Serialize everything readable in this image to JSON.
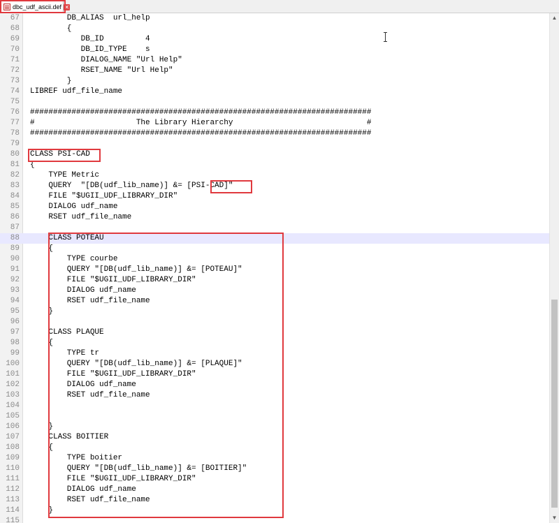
{
  "tab": {
    "label": "dbc_udf_ascii.def",
    "close_glyph": "✕",
    "icon": "file-icon"
  },
  "accent_color": "#e0393e",
  "current_line_number": "88",
  "lines": [
    {
      "n": "67",
      "t": "        DB_ALIAS  url_help"
    },
    {
      "n": "68",
      "t": "        {"
    },
    {
      "n": "69",
      "t": "           DB_ID         4"
    },
    {
      "n": "70",
      "t": "           DB_ID_TYPE    s"
    },
    {
      "n": "71",
      "t": "           DIALOG_NAME \"Url Help\""
    },
    {
      "n": "72",
      "t": "           RSET_NAME \"Url Help\""
    },
    {
      "n": "73",
      "t": "        }"
    },
    {
      "n": "74",
      "t": "LIBREF udf_file_name"
    },
    {
      "n": "75",
      "t": ""
    },
    {
      "n": "76",
      "t": "##########################################################################"
    },
    {
      "n": "77",
      "t": "#                      The Library Hierarchy                             #"
    },
    {
      "n": "78",
      "t": "##########################################################################"
    },
    {
      "n": "79",
      "t": ""
    },
    {
      "n": "80",
      "t": "CLASS PSI-CAD"
    },
    {
      "n": "81",
      "t": "{"
    },
    {
      "n": "82",
      "t": "    TYPE Metric"
    },
    {
      "n": "83",
      "t": "    QUERY  \"[DB(udf_lib_name)] &= [PSI-CAD]\""
    },
    {
      "n": "84",
      "t": "    FILE \"$UGII_UDF_LIBRARY_DIR\""
    },
    {
      "n": "85",
      "t": "    DIALOG udf_name"
    },
    {
      "n": "86",
      "t": "    RSET udf_file_name"
    },
    {
      "n": "87",
      "t": ""
    },
    {
      "n": "88",
      "t": "    CLASS POTEAU"
    },
    {
      "n": "89",
      "t": "    {"
    },
    {
      "n": "90",
      "t": "        TYPE courbe"
    },
    {
      "n": "91",
      "t": "        QUERY \"[DB(udf_lib_name)] &= [POTEAU]\""
    },
    {
      "n": "92",
      "t": "        FILE \"$UGII_UDF_LIBRARY_DIR\""
    },
    {
      "n": "93",
      "t": "        DIALOG udf_name"
    },
    {
      "n": "94",
      "t": "        RSET udf_file_name"
    },
    {
      "n": "95",
      "t": "    }"
    },
    {
      "n": "96",
      "t": ""
    },
    {
      "n": "97",
      "t": "    CLASS PLAQUE"
    },
    {
      "n": "98",
      "t": "    {"
    },
    {
      "n": "99",
      "t": "        TYPE tr"
    },
    {
      "n": "100",
      "t": "        QUERY \"[DB(udf_lib_name)] &= [PLAQUE]\""
    },
    {
      "n": "101",
      "t": "        FILE \"$UGII_UDF_LIBRARY_DIR\""
    },
    {
      "n": "102",
      "t": "        DIALOG udf_name"
    },
    {
      "n": "103",
      "t": "        RSET udf_file_name"
    },
    {
      "n": "104",
      "t": ""
    },
    {
      "n": "105",
      "t": ""
    },
    {
      "n": "106",
      "t": "    }"
    },
    {
      "n": "107",
      "t": "    CLASS BOITIER"
    },
    {
      "n": "108",
      "t": "    {"
    },
    {
      "n": "109",
      "t": "        TYPE boitier"
    },
    {
      "n": "110",
      "t": "        QUERY \"[DB(udf_lib_name)] &= [BOITIER]\""
    },
    {
      "n": "111",
      "t": "        FILE \"$UGII_UDF_LIBRARY_DIR\""
    },
    {
      "n": "112",
      "t": "        DIALOG udf_name"
    },
    {
      "n": "113",
      "t": "        RSET udf_file_name"
    },
    {
      "n": "114",
      "t": "    }"
    },
    {
      "n": "115",
      "t": ""
    }
  ]
}
